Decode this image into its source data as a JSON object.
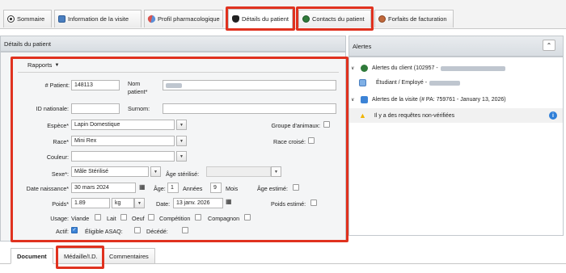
{
  "tabs": [
    {
      "label": "Sommaire",
      "icon": "eye-icon"
    },
    {
      "label": "Information de la visite",
      "icon": "visit-info-icon"
    },
    {
      "label": "Profil pharmacologique",
      "icon": "pill-icon"
    },
    {
      "label": "Détails du patient",
      "icon": "pet-icon"
    },
    {
      "label": "Contacts du patient",
      "icon": "contact-icon"
    },
    {
      "label": "Forfaits de facturation",
      "icon": "billing-icon"
    }
  ],
  "panel": {
    "title": "Détails du patient",
    "reports": "Rapports"
  },
  "form": {
    "patient_no_label": "# Patient:",
    "patient_no": "148113",
    "nom_label": "Nom patient*",
    "national_id_label": "ID nationale:",
    "surnom_label": "Surnom:",
    "espece_label": "Espèce*",
    "espece": "Lapin Domestique",
    "groupe_label": "Groupe d'animaux:",
    "race_label": "Race*",
    "race": "Mini Rex",
    "race_croise_label": "Race croisé:",
    "couleur_label": "Couleur:",
    "couleur": "",
    "sexe_label": "Sexe*:",
    "sexe": "Mâle Stérilisé",
    "age_sterilise_label": "Âge stérilisé:",
    "age_sterilise": "",
    "naissance_label": "Date naissance*",
    "naissance": "30 mars 2024",
    "age_label": "Âge:",
    "age_years": "1",
    "annees_label": "Années",
    "age_months": "9",
    "mois_label": "Mois",
    "age_estime_label": "Âge estimé:",
    "poids_label": "Poids*",
    "poids": "1.89",
    "unit": "kg",
    "date_label": "Date:",
    "date": "13 janv. 2026",
    "poids_estime_label": "Poids estimé:",
    "usage_label": "Usage:",
    "usage_options": [
      "Viande",
      "Lait",
      "Oeuf",
      "Compétition",
      "Compagnon"
    ],
    "actif_label": "Actif:",
    "asaq_label": "Éligible ASAQ:",
    "decede_label": "Décédé:"
  },
  "alerts": {
    "title": "Alertes",
    "client": "Alertes du client (102957 -",
    "student": "Étudiant / Employé -",
    "visit": "Alertes de la visite (# PA: 759761 - January 13, 2026)",
    "requests": "Il y a des requêtes non-vérifiées"
  },
  "bottom_tabs": [
    "Document",
    "Médaille/I.D.",
    "Commentaires"
  ],
  "colors": {
    "highlight": "#e0321f",
    "checked": "#3c83d6",
    "info": "#2f7fd8",
    "warning": "#f0b400"
  }
}
